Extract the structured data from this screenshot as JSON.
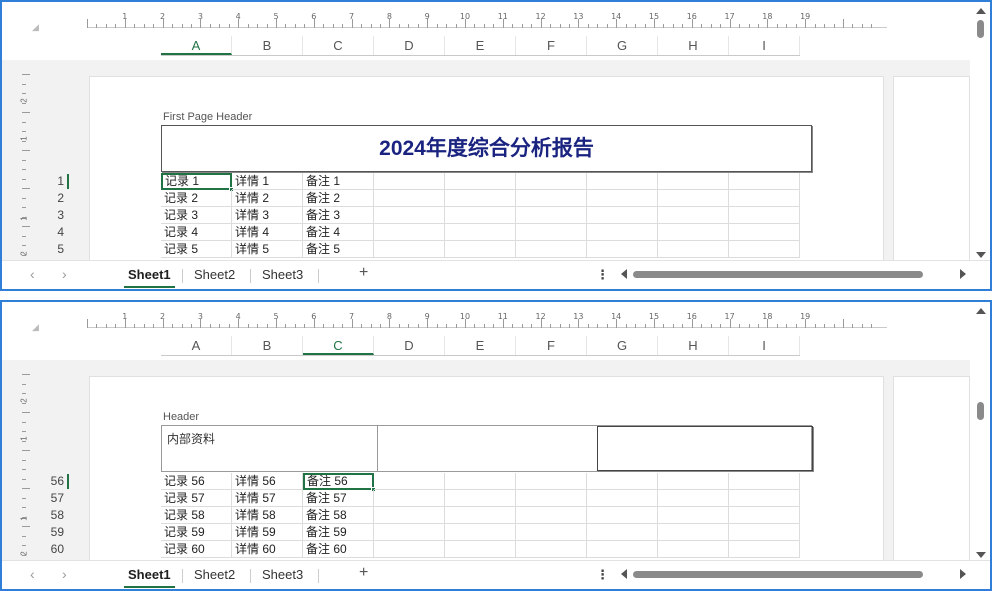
{
  "ruler": {
    "numbers": [
      "1",
      "2",
      "3",
      "4",
      "5",
      "6",
      "7",
      "8",
      "9",
      "10",
      "11",
      "12",
      "13",
      "14",
      "15",
      "16",
      "17",
      "18",
      "19"
    ]
  },
  "vruler": {
    "numbers": [
      "2",
      "1",
      "1",
      "2"
    ]
  },
  "columns": [
    "A",
    "B",
    "C",
    "D",
    "E",
    "F",
    "G",
    "H",
    "I"
  ],
  "panes": [
    {
      "selected_column": "A",
      "header_label": "First Page Header",
      "header_title": "2024年度综合分析报告",
      "header_left": "",
      "rows": [
        {
          "num": "1",
          "a": "记录 1",
          "b": "详情 1",
          "c": "备注 1"
        },
        {
          "num": "2",
          "a": "记录 2",
          "b": "详情 2",
          "c": "备注 2"
        },
        {
          "num": "3",
          "a": "记录 3",
          "b": "详情 3",
          "c": "备注 3"
        },
        {
          "num": "4",
          "a": "记录 4",
          "b": "详情 4",
          "c": "备注 4"
        },
        {
          "num": "5",
          "a": "记录 5",
          "b": "详情 5",
          "c": "备注 5"
        }
      ],
      "active_row_index": 0,
      "active_col_index": 0
    },
    {
      "selected_column": "C",
      "header_label": "Header",
      "header_title": "",
      "header_left": "内部资料",
      "rows": [
        {
          "num": "56",
          "a": "记录 56",
          "b": "详情 56",
          "c": "备注 56"
        },
        {
          "num": "57",
          "a": "记录 57",
          "b": "详情 57",
          "c": "备注 57"
        },
        {
          "num": "58",
          "a": "记录 58",
          "b": "详情 58",
          "c": "备注 58"
        },
        {
          "num": "59",
          "a": "记录 59",
          "b": "详情 59",
          "c": "备注 59"
        },
        {
          "num": "60",
          "a": "记录 60",
          "b": "详情 60",
          "c": "备注 60"
        }
      ],
      "active_row_index": 0,
      "active_col_index": 2
    }
  ],
  "sheet_tabs": [
    "Sheet1",
    "Sheet2",
    "Sheet3"
  ],
  "active_tab": "Sheet1",
  "add_sheet": "+",
  "more_options": "⋮",
  "nav_prev": "‹",
  "nav_next": "›",
  "colors": {
    "accent": "#217346",
    "frame": "#2f7fd8",
    "title": "#1a2480"
  }
}
